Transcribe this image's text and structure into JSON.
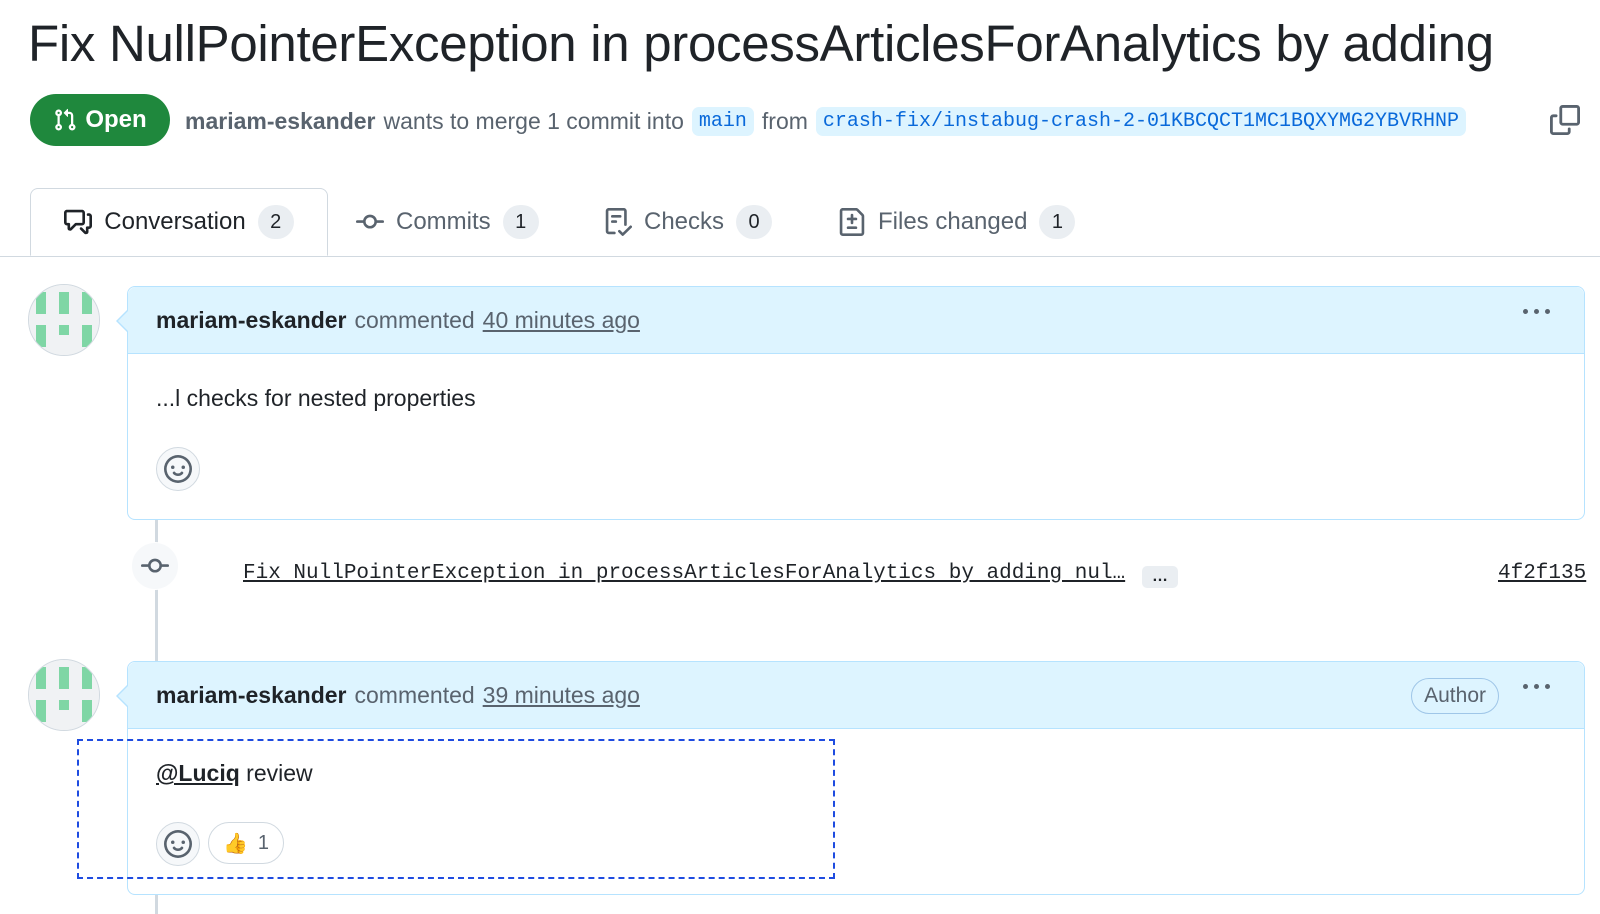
{
  "pr": {
    "title": "Fix NullPointerException in processArticlesForAnalytics by adding",
    "state": "Open",
    "author": "mariam-eskander",
    "merge_text": "wants to merge 1 commit into",
    "base_branch": "main",
    "from_text": "from",
    "head_branch": "crash-fix/instabug-crash-2-01KBCQCT1MC1BQXYMG2YBVRHNP"
  },
  "tabs": [
    {
      "label": "Conversation",
      "count": "2",
      "icon": "comment-discussion-icon"
    },
    {
      "label": "Commits",
      "count": "1",
      "icon": "git-commit-icon"
    },
    {
      "label": "Checks",
      "count": "0",
      "icon": "checklist-icon"
    },
    {
      "label": "Files changed",
      "count": "1",
      "icon": "file-diff-icon"
    }
  ],
  "timeline": {
    "comment1": {
      "author": "mariam-eskander",
      "action": "commented",
      "time": "40 minutes ago",
      "body": "...l checks for nested properties"
    },
    "commit": {
      "message": "Fix NullPointerException in processArticlesForAnalytics by adding nul…",
      "more": "…",
      "sha": "4f2f135"
    },
    "comment2": {
      "author": "mariam-eskander",
      "action": "commented",
      "time": "39 minutes ago",
      "badge": "Author",
      "mention": "@Luciq",
      "body_rest": " review",
      "reaction_emoji": "👍",
      "reaction_count": "1"
    }
  },
  "colors": {
    "open_green": "#1f883d",
    "link_blue": "#0969da",
    "comment_header_bg": "#ddf4ff",
    "selection_outline": "#1f4ce0"
  }
}
